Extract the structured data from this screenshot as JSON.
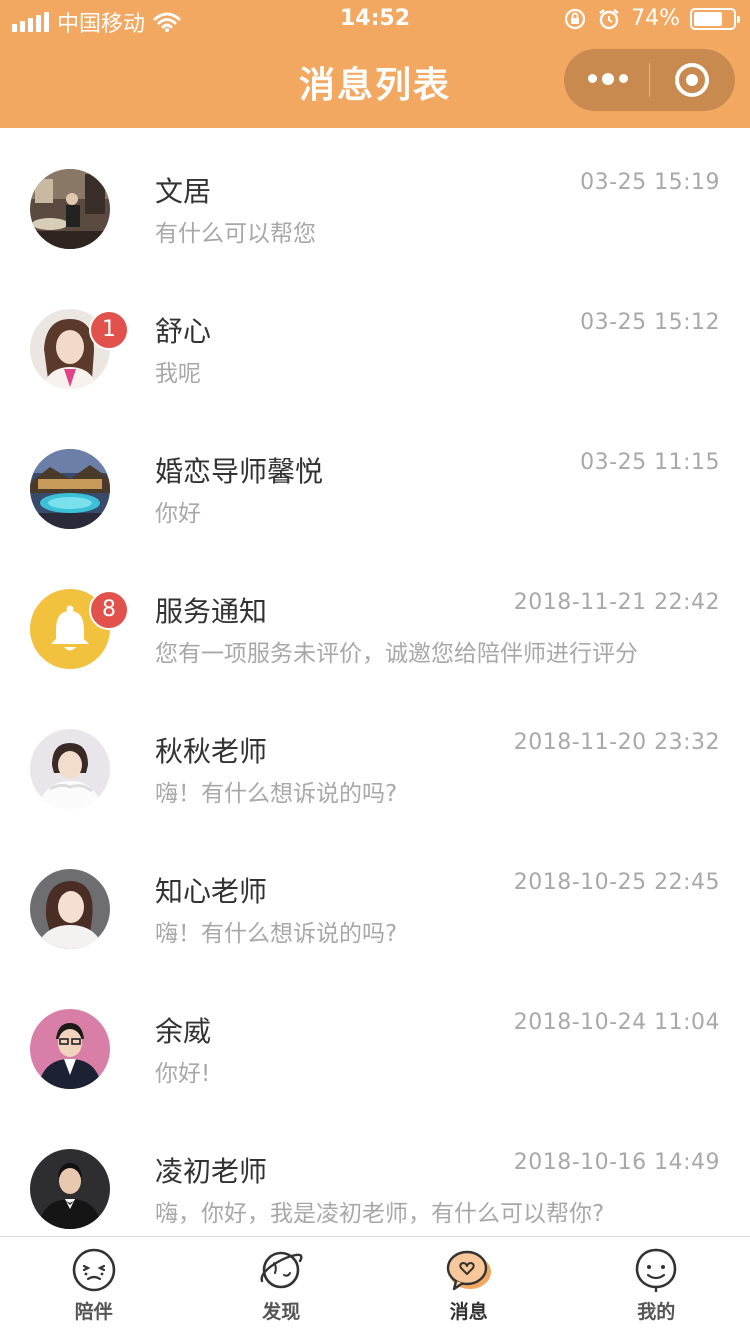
{
  "status_bar": {
    "carrier": "中国移动",
    "time": "14:52",
    "battery": "74%",
    "battery_level": 0.74
  },
  "nav": {
    "title": "消息列表"
  },
  "colors": {
    "brand": "#f3a862",
    "badge": "#e2524c",
    "notify_bg": "#f2c23e"
  },
  "messages": [
    {
      "name": "文居",
      "time": "03-25 15:19",
      "preview": "有什么可以帮您",
      "badge": "",
      "avatar": "avatar-photo-room"
    },
    {
      "name": "舒心",
      "time": "03-25 15:12",
      "preview": "我呢",
      "badge": "1",
      "avatar": "avatar-photo-woman"
    },
    {
      "name": "婚恋导师馨悦",
      "time": "03-25 11:15",
      "preview": "你好",
      "badge": "",
      "avatar": "avatar-photo-pool"
    },
    {
      "name": "服务通知",
      "time": "2018-11-21 22:42",
      "preview": "您有一项服务未评价，诚邀您给陪伴师进行评分",
      "badge": "8",
      "avatar": "bell-icon"
    },
    {
      "name": "秋秋老师",
      "time": "2018-11-20 23:32",
      "preview": "嗨！有什么想诉说的吗?",
      "badge": "",
      "avatar": "avatar-photo-woman-white"
    },
    {
      "name": "知心老师",
      "time": "2018-10-25 22:45",
      "preview": "嗨！有什么想诉说的吗?",
      "badge": "",
      "avatar": "avatar-photo-woman-gray"
    },
    {
      "name": "余威",
      "time": "2018-10-24 11:04",
      "preview": "你好!",
      "badge": "",
      "avatar": "avatar-photo-man-suit"
    },
    {
      "name": "凌初老师",
      "time": "2018-10-16 14:49",
      "preview": "嗨，你好，我是凌初老师，有什么可以帮你?",
      "badge": "",
      "avatar": "avatar-photo-man-dark"
    }
  ],
  "tabbar": {
    "tabs": [
      {
        "label": "陪伴",
        "icon": "companion-face-icon",
        "active": false
      },
      {
        "label": "发现",
        "icon": "planet-icon",
        "active": false
      },
      {
        "label": "消息",
        "icon": "message-heart-icon",
        "active": true
      },
      {
        "label": "我的",
        "icon": "profile-face-icon",
        "active": false
      }
    ]
  }
}
